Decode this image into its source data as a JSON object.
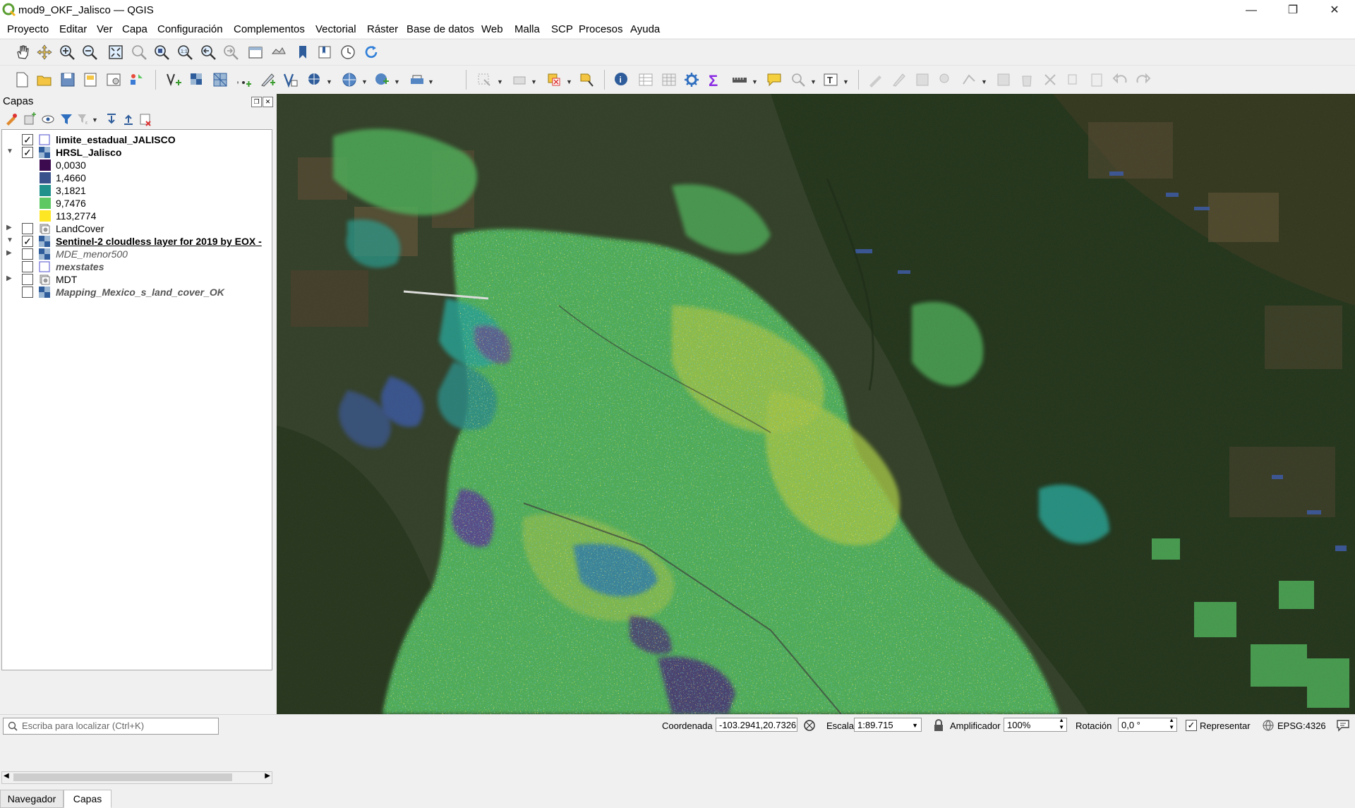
{
  "window": {
    "title": "mod9_OKF_Jalisco — QGIS",
    "controls": [
      "—",
      "❐",
      "✕"
    ]
  },
  "menu": [
    "Proyecto",
    "Editar",
    "Ver",
    "Capa",
    "Configuración",
    "Complementos",
    "Vectorial",
    "Ráster",
    "Base de datos",
    "Web",
    "Malla",
    "SCP",
    "Procesos",
    "Ayuda"
  ],
  "layers_panel": {
    "title": "Capas",
    "layers": [
      {
        "name": "limite_estadual_JALISCO",
        "checked": true,
        "style": "bold",
        "type": "vector"
      },
      {
        "name": "HRSL_Jalisco",
        "checked": true,
        "style": "bold",
        "type": "raster",
        "expanded": true
      },
      {
        "name": "LandCover",
        "checked": false,
        "style": "normal",
        "type": "wms"
      },
      {
        "name": "Sentinel-2 cloudless layer for 2019 by EOX -",
        "checked": true,
        "style": "bold-underline",
        "type": "raster"
      },
      {
        "name": "MDE_menor500",
        "checked": false,
        "style": "italic",
        "type": "raster"
      },
      {
        "name": "mexstates",
        "checked": false,
        "style": "italic",
        "type": "vector"
      },
      {
        "name": "MDT",
        "checked": false,
        "style": "normal",
        "type": "wms"
      },
      {
        "name": "Mapping_Mexico_s_land_cover_OK",
        "checked": false,
        "style": "italic",
        "type": "raster"
      }
    ],
    "legend": [
      {
        "value": "0,0030",
        "color": "#3b0a4f"
      },
      {
        "value": "1,4660",
        "color": "#3a528b"
      },
      {
        "value": "3,1821",
        "color": "#21918c"
      },
      {
        "value": "9,7476",
        "color": "#5ec962"
      },
      {
        "value": "113,2774",
        "color": "#fde725"
      }
    ]
  },
  "bottom_tabs": [
    "Navegador",
    "Capas"
  ],
  "status": {
    "locator_placeholder": "Escriba para localizar (Ctrl+K)",
    "coord_label": "Coordenada",
    "coord_value": "-103.2941,20.7326",
    "scale_label": "Escala",
    "scale_value": "1:89.715",
    "magnifier_label": "Amplificador",
    "magnifier_value": "100%",
    "rotation_label": "Rotación",
    "rotation_value": "0,0 °",
    "render_label": "Representar",
    "crs": "EPSG:4326"
  },
  "colors": {
    "accent_green": "#5ec962",
    "yellow": "#fde725",
    "purple": "#3b0a4f"
  }
}
